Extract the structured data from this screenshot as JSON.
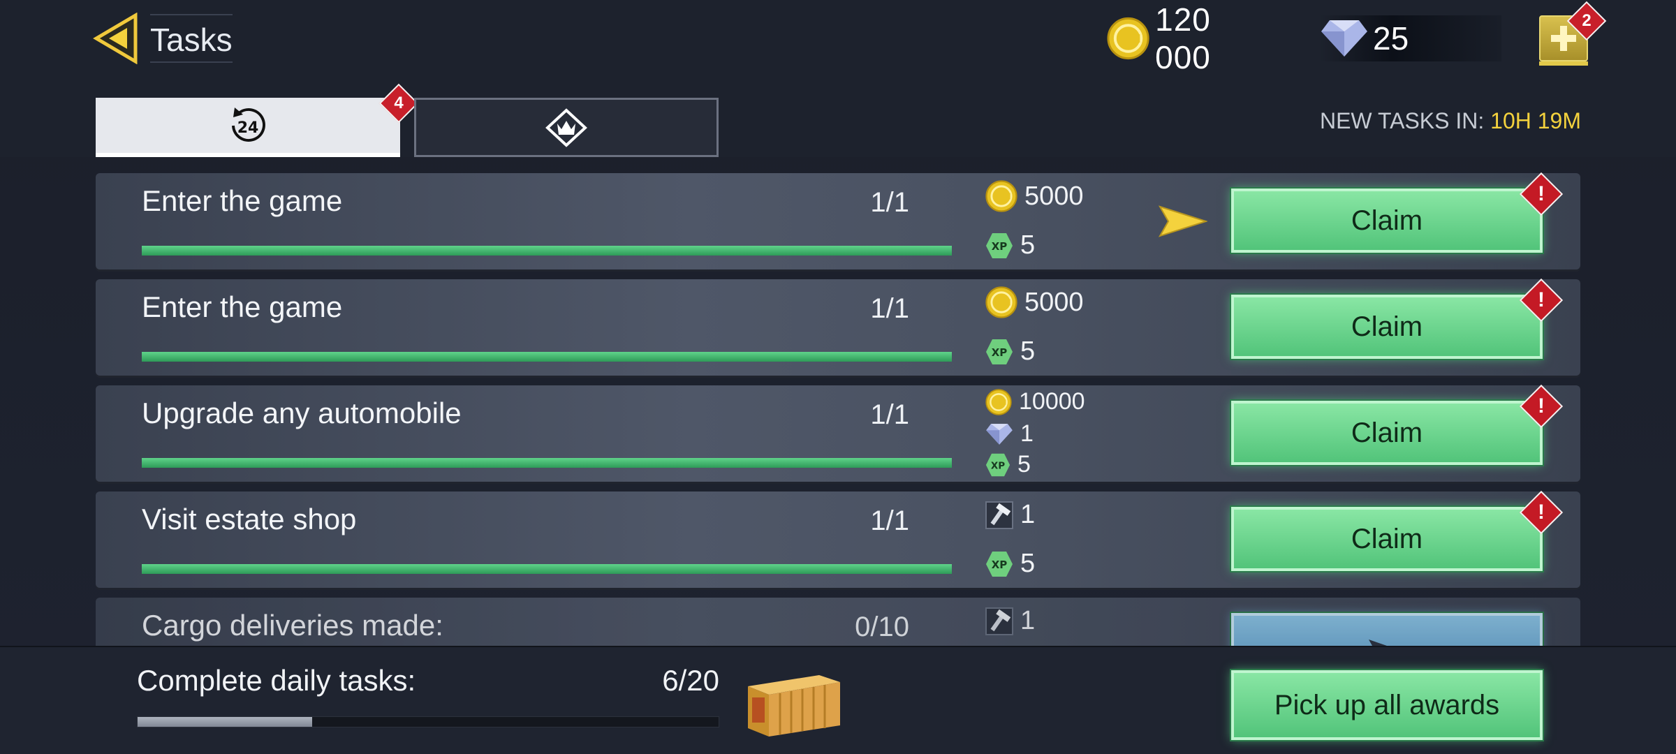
{
  "header": {
    "title": "Tasks",
    "coins": "120 000",
    "gems": "25",
    "plus_badge": "2"
  },
  "tabs": [
    {
      "name": "daily",
      "icon": "24h-clock-icon",
      "badge": "4",
      "active": true
    },
    {
      "name": "elite",
      "icon": "crown-diamond-icon",
      "active": false
    }
  ],
  "timer": {
    "label": "NEW TASKS IN:",
    "value": "10H 19M"
  },
  "tasks": [
    {
      "name": "Enter the game",
      "progress": "1/1",
      "fill": 1.0,
      "rewards": [
        {
          "icon": "coin-icon",
          "value": "5000"
        },
        {
          "icon": "xp-icon",
          "value": "5"
        }
      ],
      "button": "Claim",
      "alert": "!"
    },
    {
      "name": "Enter the game",
      "progress": "1/1",
      "fill": 1.0,
      "rewards": [
        {
          "icon": "coin-icon",
          "value": "5000"
        },
        {
          "icon": "xp-icon",
          "value": "5"
        }
      ],
      "button": "Claim",
      "alert": "!"
    },
    {
      "name": "Upgrade any automobile",
      "progress": "1/1",
      "fill": 1.0,
      "rewards": [
        {
          "icon": "coin-icon",
          "value": "10000"
        },
        {
          "icon": "gem-icon",
          "value": "1"
        },
        {
          "icon": "xp-icon",
          "value": "5"
        }
      ],
      "button": "Claim",
      "alert": "!"
    },
    {
      "name": "Visit estate shop",
      "progress": "1/1",
      "fill": 1.0,
      "rewards": [
        {
          "icon": "hammer-icon",
          "value": "1"
        },
        {
          "icon": "xp-icon",
          "value": "5"
        }
      ],
      "button": "Claim",
      "alert": "!"
    },
    {
      "name": "Cargo deliveries made:",
      "progress": "0/10",
      "fill": 0.0,
      "rewards": [
        {
          "icon": "hammer-icon",
          "value": "1"
        }
      ],
      "button": ""
    }
  ],
  "footer": {
    "label": "Complete daily tasks:",
    "count": "6/20",
    "fill": 0.3,
    "button": "Pick up all awards"
  },
  "colors": {
    "accent_gold": "#f4d23d",
    "claim_green": "#52c47a",
    "alert_red": "#c41a25",
    "go_blue": "#5c9dc9"
  }
}
